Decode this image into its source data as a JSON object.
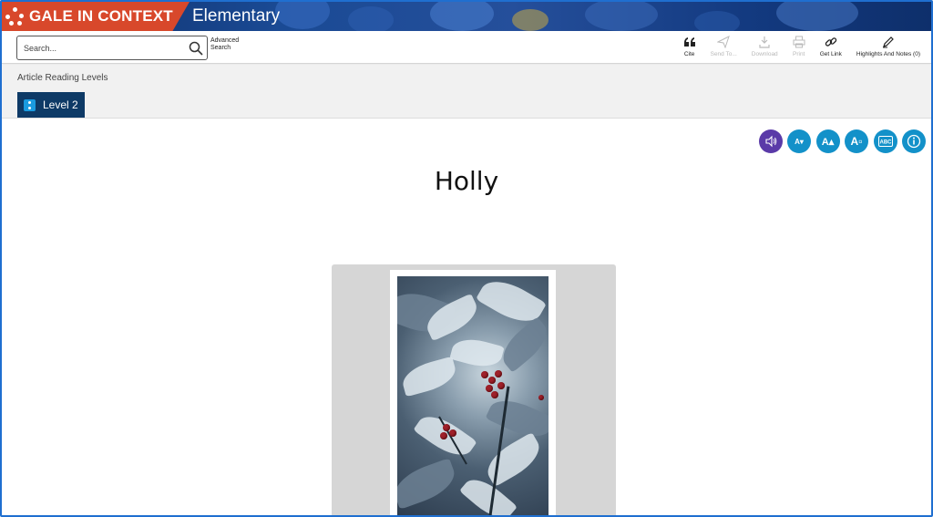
{
  "app": {
    "brand": "GALE IN CONTEXT",
    "edition": "Elementary",
    "brand_color": "#d8482b",
    "header_color": "#0d2d66"
  },
  "search": {
    "placeholder": "Search...",
    "value": "",
    "advanced_label": "Advanced Search"
  },
  "tools": [
    {
      "label": "Cite",
      "icon": "quote-icon",
      "enabled": true
    },
    {
      "label": "Send To...",
      "icon": "send-icon",
      "enabled": false
    },
    {
      "label": "Download",
      "icon": "download-icon",
      "enabled": false
    },
    {
      "label": "Print",
      "icon": "print-icon",
      "enabled": false
    },
    {
      "label": "Get Link",
      "icon": "link-icon",
      "enabled": true
    },
    {
      "label": "Highlights And Notes (0)",
      "icon": "pencil-icon",
      "enabled": true
    }
  ],
  "reading_levels": {
    "title": "Article Reading Levels",
    "active_level": "Level 2"
  },
  "accessibility_tools": [
    {
      "name": "read-aloud",
      "icon": "speaker-icon",
      "color": "#5a3aa8"
    },
    {
      "name": "decrease-text-size",
      "icon": "text-smaller-icon",
      "color": "#1391c9"
    },
    {
      "name": "increase-text-size",
      "icon": "text-larger-icon",
      "color": "#1391c9"
    },
    {
      "name": "text-style",
      "icon": "text-style-icon",
      "color": "#1391c9"
    },
    {
      "name": "translate",
      "icon": "abc-icon",
      "color": "#1391c9"
    },
    {
      "name": "info",
      "icon": "info-icon",
      "color": "#1391c9"
    }
  ],
  "article": {
    "title": "Holly",
    "image_subject": "holly-photo"
  }
}
